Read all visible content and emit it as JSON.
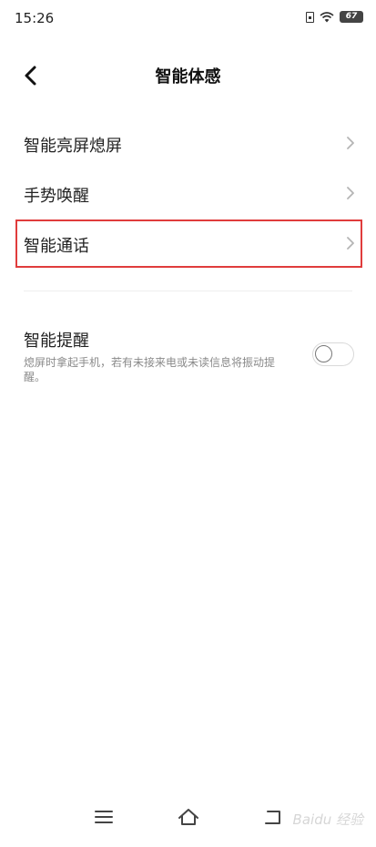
{
  "status_bar": {
    "time": "15:26",
    "battery": "67",
    "icons": [
      "sim-icon",
      "wifi-icon",
      "battery-icon"
    ]
  },
  "header": {
    "title": "智能体感",
    "back_icon": "back-arrow-icon"
  },
  "menu": {
    "items": [
      {
        "label": "智能亮屏熄屏",
        "icon": "chevron-right-icon",
        "highlighted": false
      },
      {
        "label": "手势唤醒",
        "icon": "chevron-right-icon",
        "highlighted": false
      },
      {
        "label": "智能通话",
        "icon": "chevron-right-icon",
        "highlighted": true
      }
    ]
  },
  "smart_reminder": {
    "title": "智能提醒",
    "description": "熄屏时拿起手机，若有未接来电或未读信息将振动提醒。",
    "enabled": false
  },
  "nav_bar": {
    "buttons": [
      "menu-icon",
      "home-icon",
      "back-icon"
    ]
  },
  "watermark": "Baidu 经验",
  "colors": {
    "highlight_border": "#e03c3c",
    "background": "#ffffff",
    "secondary_text": "#8a8a8a"
  }
}
